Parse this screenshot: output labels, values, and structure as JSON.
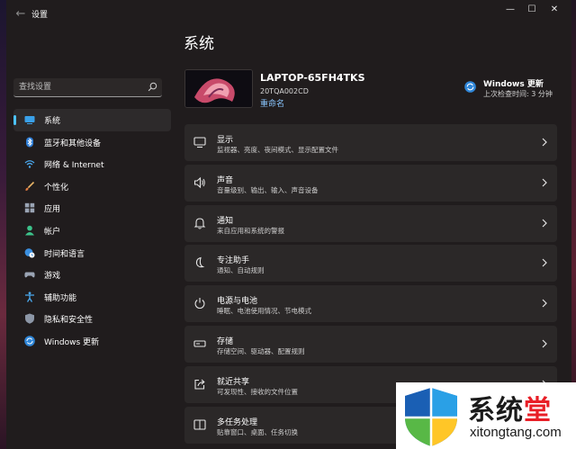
{
  "window": {
    "title": "设置",
    "back_glyph": "←",
    "min_glyph": "—",
    "max_glyph": "☐",
    "close_glyph": "✕"
  },
  "search": {
    "placeholder": "查找设置",
    "icon": "search-icon"
  },
  "sidebar": {
    "items": [
      {
        "label": "系统",
        "icon": "system-icon",
        "active": true
      },
      {
        "label": "蓝牙和其他设备",
        "icon": "bluetooth-icon"
      },
      {
        "label": "网络 & Internet",
        "icon": "wifi-icon"
      },
      {
        "label": "个性化",
        "icon": "brush-icon"
      },
      {
        "label": "应用",
        "icon": "apps-icon"
      },
      {
        "label": "帐户",
        "icon": "account-icon"
      },
      {
        "label": "时间和语言",
        "icon": "globe-clock-icon"
      },
      {
        "label": "游戏",
        "icon": "gamepad-icon"
      },
      {
        "label": "辅助功能",
        "icon": "accessibility-icon"
      },
      {
        "label": "隐私和安全性",
        "icon": "shield-icon"
      },
      {
        "label": "Windows 更新",
        "icon": "update-icon"
      }
    ]
  },
  "main": {
    "title": "系统",
    "device": {
      "name": "LAPTOP-65FH4TKS",
      "model": "20TQA002CD",
      "rename": "重命名"
    },
    "windows_update": {
      "title": "Windows 更新",
      "status": "上次检查时间: 3 分钟"
    },
    "cards": [
      {
        "title": "显示",
        "desc": "监视器、亮度、夜间模式、显示配置文件",
        "icon": "display-icon"
      },
      {
        "title": "声音",
        "desc": "音量级别、输出、输入、声音设备",
        "icon": "speaker-icon"
      },
      {
        "title": "通知",
        "desc": "来自应用和系统的警报",
        "icon": "bell-icon"
      },
      {
        "title": "专注助手",
        "desc": "通知、自动规则",
        "icon": "moon-icon"
      },
      {
        "title": "电源与电池",
        "desc": "睡眠、电池使用情况、节电模式",
        "icon": "power-icon"
      },
      {
        "title": "存储",
        "desc": "存储空间、驱动器、配置规则",
        "icon": "storage-icon"
      },
      {
        "title": "就近共享",
        "desc": "可发现性、接收的文件位置",
        "icon": "share-icon"
      },
      {
        "title": "多任务处理",
        "desc": "贴靠窗口、桌面、任务切换",
        "icon": "multitask-icon"
      }
    ]
  },
  "watermark": {
    "brand_main": "系统",
    "brand_accent": "堂",
    "url": "xitongtang.com"
  },
  "colors": {
    "accent": "#4cc2ff",
    "link": "#8ac6ff",
    "window_bg": "#201c1d",
    "card_bg": "#2b2828"
  }
}
